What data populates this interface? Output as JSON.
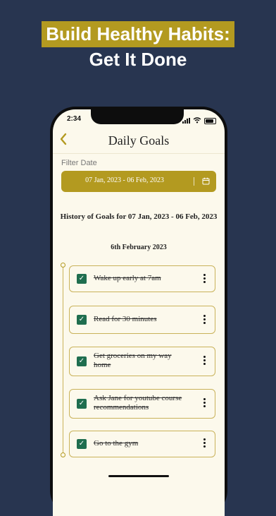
{
  "promo": {
    "headline": "Build Healthy Habits:",
    "subheadline": "Get It Done"
  },
  "status_bar": {
    "time": "2:34"
  },
  "header": {
    "title": "Daily Goals",
    "back_icon": "chevron-left-icon"
  },
  "filter": {
    "label": "Filter Date",
    "date_range": "07 Jan, 2023 - 06 Feb, 2023",
    "calendar_icon": "calendar-icon"
  },
  "history_title": "History of Goals for 07 Jan, 2023 - 06 Feb, 2023",
  "day_heading": "6th February 2023",
  "goals": [
    {
      "text": "Wake up early at 7am",
      "completed": true
    },
    {
      "text": "Read for 30 minutes",
      "completed": true
    },
    {
      "text": "Get groceries on my way home",
      "completed": true
    },
    {
      "text": "Ask Jane for youtube course recommendations",
      "completed": true
    },
    {
      "text": "Go to the gym",
      "completed": true
    }
  ],
  "colors": {
    "background": "#283550",
    "accent": "#b39a20",
    "check": "#1f6e4f",
    "screen": "#fcf9ec"
  }
}
